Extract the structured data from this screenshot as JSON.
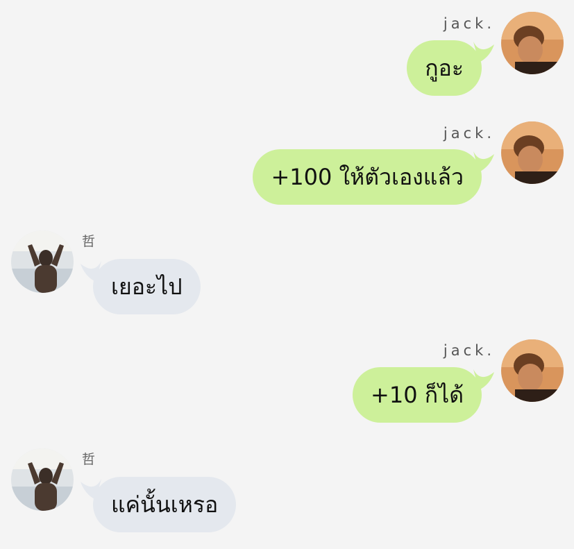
{
  "messages": [
    {
      "sender": "jack.",
      "side": "right",
      "text": "กูอะ"
    },
    {
      "sender": "jack.",
      "side": "right",
      "text": "+100 ให้ตัวเองแล้ว"
    },
    {
      "sender": "哲",
      "side": "left",
      "text": "เยอะไป"
    },
    {
      "sender": "jack.",
      "side": "right",
      "text": "+10 ก็ได้"
    },
    {
      "sender": "哲",
      "side": "left",
      "text": "แค่นั้นเหรอ"
    }
  ],
  "colors": {
    "background": "#f4f4f4",
    "my_bubble": "#cdf09a",
    "their_bubble": "#e4e8ee"
  },
  "icons": {
    "my_avatar": "person-photo-avatar",
    "their_avatar": "person-photo-avatar"
  }
}
